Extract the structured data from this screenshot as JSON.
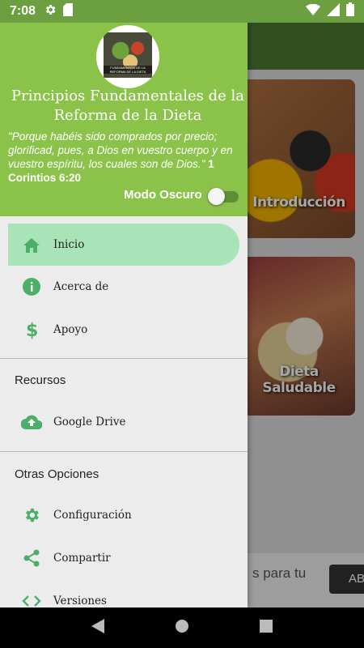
{
  "status_bar": {
    "time": "7:08",
    "icons": [
      "settings-icon",
      "sd-card-icon",
      "wifi-icon",
      "signal-icon",
      "battery-icon"
    ]
  },
  "background_app": {
    "cards": [
      {
        "title": "Introducción"
      },
      {
        "title": "Dieta Saludable"
      }
    ],
    "ad": {
      "text": "s para tu",
      "button_label": "AB"
    }
  },
  "drawer": {
    "logo_text": "FUNDAMENTOS DE LA REFORMA DE LA DIETA",
    "title": "Principios Fundamentales de la Reforma de la Dieta",
    "quote": "\"Porque habéis sido comprados por precio; glorificad, pues, a Dios en vuestro cuerpo y en vuestro espíritu, los cuales son de Dios.\"",
    "quote_ref": "1 Corintios 6:20",
    "dark_mode_label": "Modo Oscuro",
    "dark_mode_enabled": false,
    "menu": [
      {
        "label": "Inicio",
        "icon": "home-icon",
        "active": true
      },
      {
        "label": "Acerca de",
        "icon": "info-icon",
        "active": false
      },
      {
        "label": "Apoyo",
        "icon": "dollar-icon",
        "active": false
      }
    ],
    "section_resources": {
      "title": "Recursos",
      "items": [
        {
          "label": "Google Drive",
          "icon": "cloud-upload-icon"
        }
      ]
    },
    "section_other": {
      "title": "Otras Opciones",
      "items": [
        {
          "label": "Configuración",
          "icon": "gear-icon"
        },
        {
          "label": "Compartir",
          "icon": "share-icon"
        },
        {
          "label": "Versiones",
          "icon": "code-icon"
        }
      ]
    }
  },
  "colors": {
    "header_green": "#8bc34a",
    "status_green": "#6b9f3f",
    "active_item_bg": "#a8e4b8",
    "icon_green": "#4caf68"
  },
  "nav_bar": {
    "buttons": [
      "back-icon",
      "home-circle-icon",
      "recents-icon"
    ]
  }
}
